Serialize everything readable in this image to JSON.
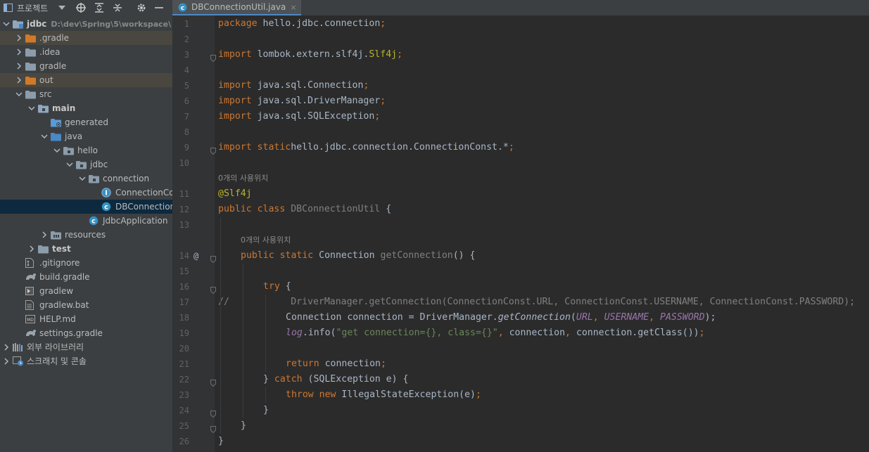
{
  "project_panel": {
    "title": "프로젝트",
    "tree": [
      {
        "label": "jdbc",
        "path": "D:\\dev\\Spring\\5\\workspace\\",
        "indent": 0,
        "arrow": "down",
        "icon": "module",
        "bold": true
      },
      {
        "label": ".gradle",
        "indent": 1,
        "arrow": "right",
        "icon": "folder-orange",
        "hl": true
      },
      {
        "label": ".idea",
        "indent": 1,
        "arrow": "right",
        "icon": "folder"
      },
      {
        "label": "gradle",
        "indent": 1,
        "arrow": "right",
        "icon": "folder"
      },
      {
        "label": "out",
        "indent": 1,
        "arrow": "right",
        "icon": "folder-orange",
        "hl": true
      },
      {
        "label": "src",
        "indent": 1,
        "arrow": "down",
        "icon": "folder"
      },
      {
        "label": "main",
        "indent": 2,
        "arrow": "down",
        "icon": "folder-module",
        "bold": true
      },
      {
        "label": "generated",
        "indent": 3,
        "arrow": "",
        "icon": "folder-generated"
      },
      {
        "label": "java",
        "indent": 3,
        "arrow": "down",
        "icon": "folder-blue"
      },
      {
        "label": "hello",
        "indent": 4,
        "arrow": "down",
        "icon": "package"
      },
      {
        "label": "jdbc",
        "indent": 5,
        "arrow": "down",
        "icon": "package"
      },
      {
        "label": "connection",
        "indent": 6,
        "arrow": "down",
        "icon": "package"
      },
      {
        "label": "ConnectionConst",
        "indent": 7,
        "arrow": "",
        "icon": "interface"
      },
      {
        "label": "DBConnectionUtil",
        "indent": 7,
        "arrow": "",
        "icon": "class",
        "sel": true
      },
      {
        "label": "JdbcApplication",
        "indent": 6,
        "arrow": "",
        "icon": "spring-class"
      },
      {
        "label": "resources",
        "indent": 3,
        "arrow": "right",
        "icon": "folder-resources"
      },
      {
        "label": "test",
        "indent": 2,
        "arrow": "right",
        "icon": "folder-test",
        "bold": true
      },
      {
        "label": ".gitignore",
        "indent": 1,
        "arrow": "",
        "icon": "file-git"
      },
      {
        "label": "build.gradle",
        "indent": 1,
        "arrow": "",
        "icon": "gradle-file"
      },
      {
        "label": "gradlew",
        "indent": 1,
        "arrow": "",
        "icon": "file-shell"
      },
      {
        "label": "gradlew.bat",
        "indent": 1,
        "arrow": "",
        "icon": "file-text"
      },
      {
        "label": "HELP.md",
        "indent": 1,
        "arrow": "",
        "icon": "file-md"
      },
      {
        "label": "settings.gradle",
        "indent": 1,
        "arrow": "",
        "icon": "gradle-file"
      },
      {
        "label": "외부 라이브러리",
        "indent": 0,
        "arrow": "right",
        "icon": "libraries"
      },
      {
        "label": "스크래치 및 콘솔",
        "indent": 0,
        "arrow": "right",
        "icon": "scratches"
      }
    ]
  },
  "editor": {
    "tab": {
      "label": "DBConnectionUtil.java",
      "close": "×"
    },
    "hint_text": "0개의 사용위치",
    "lines": [
      {
        "type": "line",
        "n": "1",
        "indent": 0,
        "tokens": [
          [
            "kw",
            "package"
          ],
          [
            "",
            "hello.jdbc.connection"
          ],
          [
            "kw",
            ";"
          ]
        ]
      },
      {
        "type": "line",
        "n": "2",
        "indent": 0,
        "tokens": []
      },
      {
        "type": "line",
        "n": "3",
        "indent": 0,
        "fold": true,
        "tokens": [
          [
            "kw",
            "import"
          ],
          [
            "",
            "lombok.extern.slf4j."
          ],
          [
            "ann",
            "Slf4j"
          ],
          [
            "kw",
            ";"
          ]
        ]
      },
      {
        "type": "line",
        "n": "4",
        "indent": 0,
        "tokens": []
      },
      {
        "type": "line",
        "n": "5",
        "indent": 0,
        "tokens": [
          [
            "kw",
            "import"
          ],
          [
            "",
            "java.sql.Connection"
          ],
          [
            "kw",
            ";"
          ]
        ]
      },
      {
        "type": "line",
        "n": "6",
        "indent": 0,
        "tokens": [
          [
            "kw",
            "import"
          ],
          [
            "",
            "java.sql.DriverManager"
          ],
          [
            "kw",
            ";"
          ]
        ]
      },
      {
        "type": "line",
        "n": "7",
        "indent": 0,
        "tokens": [
          [
            "kw",
            "import"
          ],
          [
            "",
            "java.sql.SQLException"
          ],
          [
            "kw",
            ";"
          ]
        ]
      },
      {
        "type": "line",
        "n": "8",
        "indent": 0,
        "tokens": []
      },
      {
        "type": "line",
        "n": "9",
        "indent": 0,
        "fold": true,
        "tokens": [
          [
            "kw",
            "import static"
          ],
          [
            "",
            "hello.jdbc.connection.ConnectionConst.*"
          ],
          [
            "kw",
            ";"
          ]
        ]
      },
      {
        "type": "line",
        "n": "10",
        "indent": 0,
        "tokens": []
      },
      {
        "type": "hint",
        "indent": 0
      },
      {
        "type": "line",
        "n": "11",
        "indent": 0,
        "tokens": [
          [
            "ann",
            "@Slf4j"
          ]
        ]
      },
      {
        "type": "line",
        "n": "12",
        "indent": 0,
        "tokens": [
          [
            "kw",
            "public class "
          ],
          [
            "gray",
            "DBConnectionUtil"
          ],
          [
            "",
            " {"
          ]
        ]
      },
      {
        "type": "line",
        "n": "13",
        "indent": 0,
        "tokens": []
      },
      {
        "type": "hint",
        "indent": 4
      },
      {
        "type": "line",
        "n": "14",
        "indent": 4,
        "mark": "@",
        "fold": true,
        "tokens": [
          [
            "kw",
            "public static "
          ],
          [
            "",
            "Connection "
          ],
          [
            "gray",
            "getConnection"
          ],
          [
            "",
            "() {"
          ]
        ]
      },
      {
        "type": "line",
        "n": "15",
        "indent": 0,
        "tokens": []
      },
      {
        "type": "line",
        "n": "16",
        "indent": 8,
        "fold": true,
        "tokens": [
          [
            "kw",
            "try "
          ],
          [
            "",
            "{"
          ]
        ]
      },
      {
        "type": "line",
        "n": "17",
        "indent": 0,
        "tokens": [
          [
            "gray",
            "//           DriverManager.getConnection(ConnectionConst.URL, ConnectionConst.USERNAME, ConnectionConst.PASSWORD);"
          ]
        ]
      },
      {
        "type": "line",
        "n": "18",
        "indent": 12,
        "tokens": [
          [
            "",
            "Connection connection = DriverManager."
          ],
          [
            "mcall",
            "getConnection"
          ],
          [
            "",
            "("
          ],
          [
            "fld",
            "URL"
          ],
          [
            "kw",
            ", "
          ],
          [
            "fld",
            "USERNAME"
          ],
          [
            "kw",
            ", "
          ],
          [
            "fld",
            "PASSWORD"
          ],
          [
            "",
            "); "
          ]
        ]
      },
      {
        "type": "line",
        "n": "19",
        "indent": 12,
        "tokens": [
          [
            "fld",
            "log"
          ],
          [
            "",
            ".info("
          ],
          [
            "str",
            "\"get connection={}, class={}\""
          ],
          [
            "kw",
            ", "
          ],
          [
            "",
            "connection"
          ],
          [
            "kw",
            ", "
          ],
          [
            "",
            "connection.getClass())"
          ],
          [
            "kw",
            ";"
          ]
        ]
      },
      {
        "type": "line",
        "n": "20",
        "indent": 0,
        "tokens": []
      },
      {
        "type": "line",
        "n": "21",
        "indent": 12,
        "tokens": [
          [
            "kw",
            "return "
          ],
          [
            "",
            "connection"
          ],
          [
            "kw",
            ";"
          ]
        ]
      },
      {
        "type": "line",
        "n": "22",
        "indent": 8,
        "fold": true,
        "tokens": [
          [
            "",
            "} "
          ],
          [
            "kw",
            "catch "
          ],
          [
            "",
            "(SQLException e) {"
          ]
        ]
      },
      {
        "type": "line",
        "n": "23",
        "indent": 12,
        "tokens": [
          [
            "kw",
            "throw new "
          ],
          [
            "",
            "IllegalStateException(e)"
          ],
          [
            "kw",
            ";"
          ]
        ]
      },
      {
        "type": "line",
        "n": "24",
        "indent": 8,
        "fold": true,
        "tokens": [
          [
            "",
            "}"
          ]
        ]
      },
      {
        "type": "line",
        "n": "25",
        "indent": 4,
        "fold": true,
        "tokens": [
          [
            "",
            "}"
          ]
        ]
      },
      {
        "type": "line",
        "n": "26",
        "indent": 0,
        "tokens": [
          [
            "",
            "}"
          ]
        ]
      }
    ]
  },
  "colors": {
    "keyword": "#cc7832",
    "annotation": "#bbb529",
    "string": "#6a8759",
    "field": "#9876aa",
    "plain": "#a9b7c6",
    "selection": "#0d293e",
    "folder_excluded": "#d07a29",
    "folder_source": "#4a88c7"
  }
}
